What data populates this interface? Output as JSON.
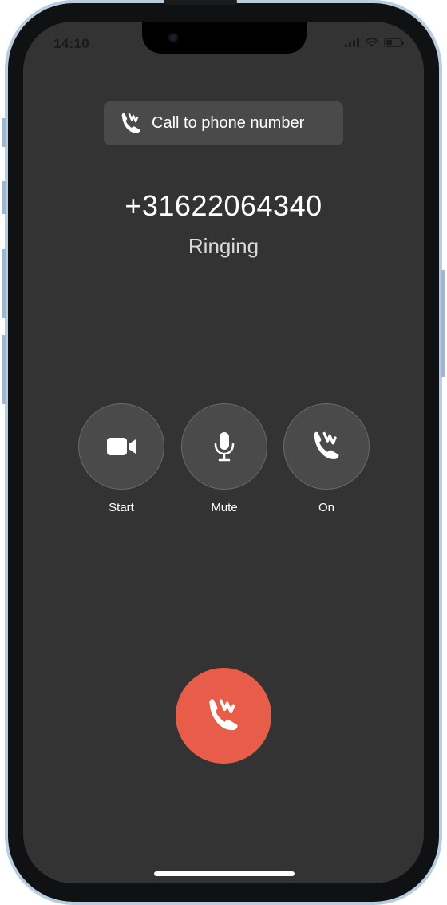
{
  "status_bar": {
    "time": "14:10"
  },
  "call": {
    "type_label": "Call to phone number",
    "number": "+31622064340",
    "status": "Ringing"
  },
  "controls": [
    {
      "label": "Start",
      "icon": "video-camera-icon"
    },
    {
      "label": "Mute",
      "icon": "microphone-icon"
    },
    {
      "label": "On",
      "icon": "phone-handset-icon"
    }
  ],
  "hangup": {
    "icon": "phone-handset-icon"
  },
  "colors": {
    "screen_bg": "#333333",
    "button_bg": "#4a4a4a",
    "hangup_bg": "#e85c4a",
    "frame": "#b9cde0"
  }
}
